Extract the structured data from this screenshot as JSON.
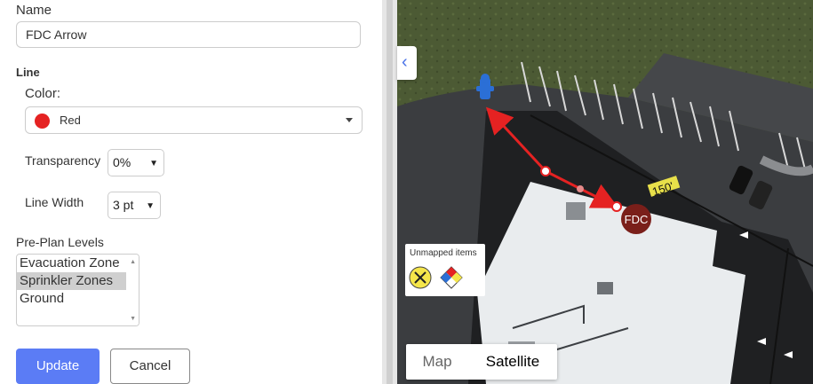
{
  "form": {
    "name_label": "Name",
    "name_value": "FDC Arrow",
    "line_section": "Line",
    "color_label": "Color:",
    "color_value": "Red",
    "color_hex": "#e52222",
    "transparency_label": "Transparency",
    "transparency_value": "0%",
    "line_width_label": "Line Width",
    "line_width_value": "3 pt",
    "levels_label": "Pre-Plan Levels",
    "levels_options": [
      "Evacuation Zone",
      "Sprinkler Zones",
      "Ground"
    ],
    "levels_selected": "Sprinkler Zones",
    "update_label": "Update",
    "cancel_label": "Cancel"
  },
  "map": {
    "collapse_glyph": "‹",
    "fdc_label": "FDC",
    "distance_label": "150'",
    "unmapped_title": "Unmapped items",
    "unmapped_icons": [
      "fire-riser-icon",
      "hazmat-diamond-icon"
    ],
    "map_type_options": [
      "Map",
      "Satellite"
    ],
    "map_type_selected": "Satellite",
    "colors": {
      "accent": "#5b7cf5",
      "fdc": "#7a1f1a",
      "arrow": "#e52222"
    }
  }
}
